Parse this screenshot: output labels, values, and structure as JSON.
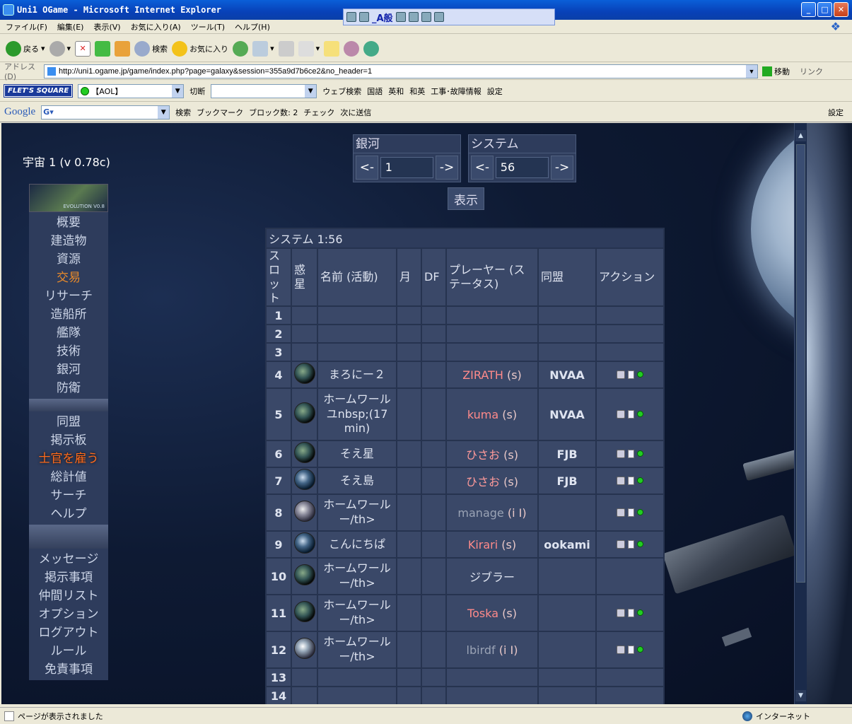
{
  "window": {
    "title": "Uni1 OGame - Microsoft Internet Explorer"
  },
  "ime": {
    "mode": "_A般"
  },
  "menubar": [
    "ファイル(F)",
    "編集(E)",
    "表示(V)",
    "お気に入り(A)",
    "ツール(T)",
    "ヘルプ(H)"
  ],
  "toolbar": {
    "back": "戻る",
    "search": "検索",
    "favorites": "お気に入り"
  },
  "address": {
    "label": "アドレス(D)",
    "url": "http://uni1.ogame.jp/game/index.php?page=galaxy&session=355a9d7b6ce2&no_header=1",
    "go": "移動",
    "links": "リンク"
  },
  "flets": {
    "logo": "FLET'S SQUARE",
    "aol": "【AOL】",
    "cut": "切断",
    "web_search": "ウェブ検索",
    "kokugo": "国語",
    "eiwa": "英和",
    "waei": "和英",
    "koji": "工事･故障情報",
    "settings": "設定"
  },
  "google": {
    "logo": "Google",
    "search": "検索",
    "bookmark": "ブックマーク",
    "blocked": "ブロック数: 2",
    "check": "チェック",
    "send": "次に送信",
    "settings": "設定"
  },
  "universe": "宇宙 1 (v 0.78c)",
  "menu_banner": "EVOLUTION V0.8",
  "menu": {
    "group1": [
      "概要",
      "建造物",
      "資源",
      "交易",
      "リサーチ",
      "造船所",
      "艦隊",
      "技術",
      "銀河",
      "防衛"
    ],
    "group2": [
      "同盟",
      "掲示板",
      "士官を雇う",
      "総計値",
      "サーチ",
      "ヘルプ"
    ],
    "group3": [
      "メッセージ",
      "掲示事項",
      "仲間リスト",
      "オプション",
      "ログアウト",
      "ルール",
      "免責事項"
    ]
  },
  "nav": {
    "galaxy_label": "銀河",
    "galaxy_value": "1",
    "system_label": "システム",
    "system_value": "56",
    "prev": "<-",
    "next": "->",
    "show": "表示"
  },
  "galaxy": {
    "caption": "システム 1:56",
    "headers": [
      "スロット",
      "惑星",
      "名前 (活動)",
      "月",
      "DF",
      "プレーヤー (ステータス)",
      "同盟",
      "アクション"
    ],
    "rows": [
      {
        "slot": "1",
        "planet": "",
        "name": "",
        "player": "",
        "status": "",
        "ally": "",
        "actions": false
      },
      {
        "slot": "2",
        "planet": "",
        "name": "",
        "player": "",
        "status": "",
        "ally": "",
        "actions": false
      },
      {
        "slot": "3",
        "planet": "",
        "name": "",
        "player": "",
        "status": "",
        "ally": "",
        "actions": false
      },
      {
        "slot": "4",
        "planet": "dark",
        "name": "まろにー２",
        "player": "ZIRATH",
        "status": "(s)",
        "ally": "NVAA",
        "actions": true,
        "color": "red"
      },
      {
        "slot": "5",
        "planet": "dark",
        "name": "ホームワールユnbsp;(17 min)",
        "player": "kuma",
        "status": "(s)",
        "ally": "NVAA",
        "actions": true,
        "color": "red"
      },
      {
        "slot": "6",
        "planet": "dark",
        "name": "そえ星",
        "player": "ひさお",
        "status": "(s)",
        "ally": "FJB",
        "actions": true,
        "color": "pink"
      },
      {
        "slot": "7",
        "planet": "blue",
        "name": "そえ島",
        "player": "ひさお",
        "status": "(s)",
        "ally": "FJB",
        "actions": true,
        "color": "pink"
      },
      {
        "slot": "8",
        "planet": "grey",
        "name": "ホームワールー/th>",
        "player": "manage",
        "status": "(i I)",
        "ally": "",
        "actions": true,
        "color": "grey"
      },
      {
        "slot": "9",
        "planet": "blue",
        "name": "こんにちぱ",
        "player": "Kirari",
        "status": "(s)",
        "ally": "ookami",
        "actions": true,
        "color": "red"
      },
      {
        "slot": "10",
        "planet": "dark",
        "name": "ホームワールー/th>",
        "player": "ジブラー",
        "status": "",
        "ally": "",
        "actions": false,
        "color": "plain"
      },
      {
        "slot": "11",
        "planet": "dark",
        "name": "ホームワールー/th>",
        "player": "Toska",
        "status": "(s)",
        "ally": "",
        "actions": true,
        "color": "red"
      },
      {
        "slot": "12",
        "planet": "icy",
        "name": "ホームワールー/th>",
        "player": "lbirdf",
        "status": "(i I)",
        "ally": "",
        "actions": true,
        "color": "grey"
      },
      {
        "slot": "13",
        "planet": "",
        "name": "",
        "player": "",
        "status": "",
        "ally": "",
        "actions": false
      },
      {
        "slot": "14",
        "planet": "",
        "name": "",
        "player": "",
        "status": "",
        "ally": "",
        "actions": false
      }
    ]
  },
  "statusbar": {
    "left": "ページが表示されました",
    "zone": "インターネット"
  },
  "colors": {
    "player_red": "#ff8a8a",
    "panel": "#3a4868",
    "active_menu": "#e88a2a"
  }
}
